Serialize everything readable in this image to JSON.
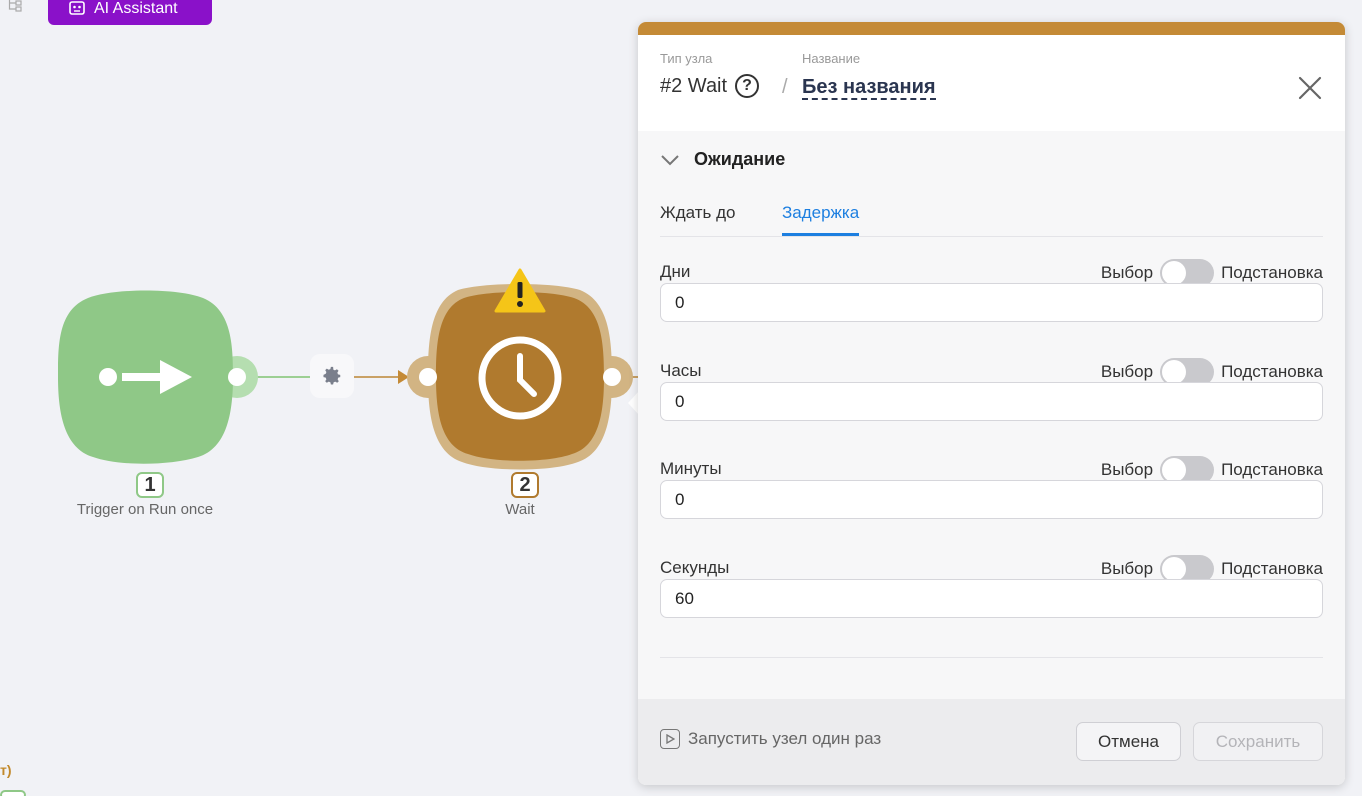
{
  "toolbar": {
    "ai_assistant_label": "AI Assistant"
  },
  "canvas": {
    "nodes": [
      {
        "number": "1",
        "label": "Trigger on Run once",
        "color": "#8fc887"
      },
      {
        "number": "2",
        "label": "Wait",
        "color": "#b07a2e"
      }
    ],
    "bottom_left_text": "т)"
  },
  "panel": {
    "accent_color": "#c48a36",
    "type_label": "Тип узла",
    "type_value": "#2 Wait",
    "help_symbol": "?",
    "separator": "/",
    "name_label": "Название",
    "name_value": "Без названия",
    "section_title": "Ожидание",
    "tabs": [
      {
        "label": "Ждать до",
        "active": false
      },
      {
        "label": "Задержка",
        "active": true
      }
    ],
    "fields": [
      {
        "label": "Дни",
        "mode_left": "Выбор",
        "mode_right": "Подстановка",
        "value": "0"
      },
      {
        "label": "Часы",
        "mode_left": "Выбор",
        "mode_right": "Подстановка",
        "value": "0"
      },
      {
        "label": "Минуты",
        "mode_left": "Выбор",
        "mode_right": "Подстановка",
        "value": "0"
      },
      {
        "label": "Секунды",
        "mode_left": "Выбор",
        "mode_right": "Подстановка",
        "value": "60"
      }
    ],
    "footer": {
      "run_once_label": "Запустить узел один раз",
      "cancel_label": "Отмена",
      "save_label": "Сохранить"
    }
  }
}
